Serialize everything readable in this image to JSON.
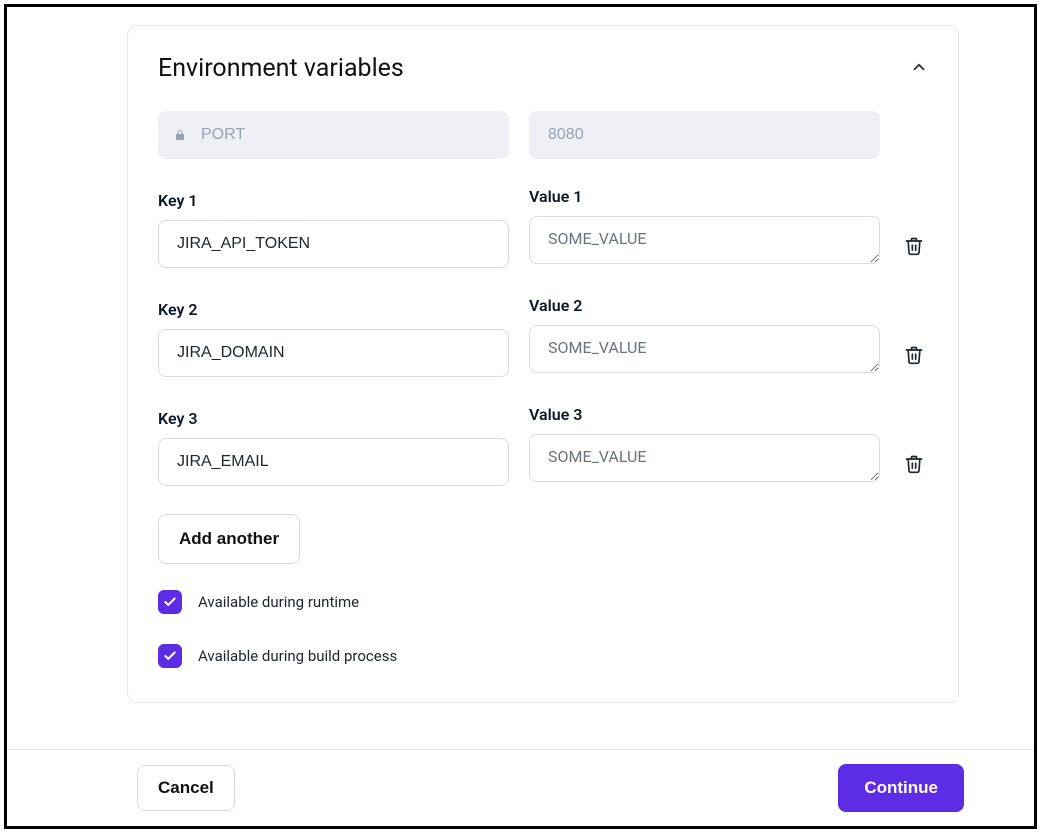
{
  "panel": {
    "title": "Environment variables",
    "port_key": "PORT",
    "port_value": "8080"
  },
  "rows": [
    {
      "key_label": "Key 1",
      "value_label": "Value 1",
      "key": "JIRA_API_TOKEN",
      "value_placeholder": "SOME_VALUE"
    },
    {
      "key_label": "Key 2",
      "value_label": "Value 2",
      "key": "JIRA_DOMAIN",
      "value_placeholder": "SOME_VALUE"
    },
    {
      "key_label": "Key 3",
      "value_label": "Value 3",
      "key": "JIRA_EMAIL",
      "value_placeholder": "SOME_VALUE"
    }
  ],
  "buttons": {
    "add_another": "Add another",
    "cancel": "Cancel",
    "continue": "Continue"
  },
  "checks": {
    "runtime": "Available during runtime",
    "build": "Available during build process"
  }
}
